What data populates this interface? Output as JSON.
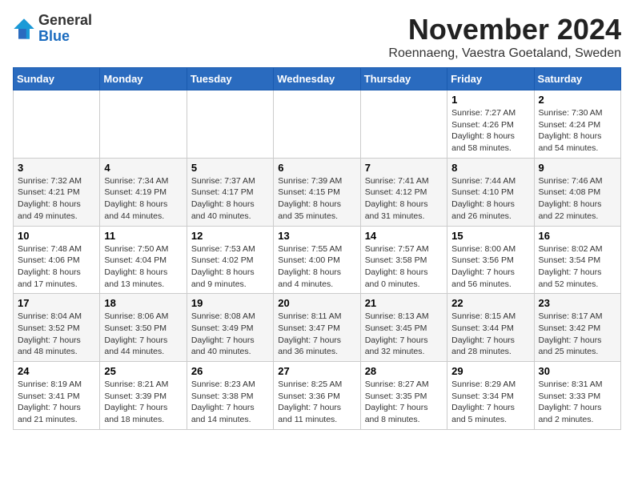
{
  "header": {
    "logo": {
      "line1": "General",
      "line2": "Blue"
    },
    "title": "November 2024",
    "subtitle": "Roennaeng, Vaestra Goetaland, Sweden"
  },
  "calendar": {
    "days_of_week": [
      "Sunday",
      "Monday",
      "Tuesday",
      "Wednesday",
      "Thursday",
      "Friday",
      "Saturday"
    ],
    "weeks": [
      [
        {
          "day": "",
          "info": ""
        },
        {
          "day": "",
          "info": ""
        },
        {
          "day": "",
          "info": ""
        },
        {
          "day": "",
          "info": ""
        },
        {
          "day": "",
          "info": ""
        },
        {
          "day": "1",
          "info": "Sunrise: 7:27 AM\nSunset: 4:26 PM\nDaylight: 8 hours\nand 58 minutes."
        },
        {
          "day": "2",
          "info": "Sunrise: 7:30 AM\nSunset: 4:24 PM\nDaylight: 8 hours\nand 54 minutes."
        }
      ],
      [
        {
          "day": "3",
          "info": "Sunrise: 7:32 AM\nSunset: 4:21 PM\nDaylight: 8 hours\nand 49 minutes."
        },
        {
          "day": "4",
          "info": "Sunrise: 7:34 AM\nSunset: 4:19 PM\nDaylight: 8 hours\nand 44 minutes."
        },
        {
          "day": "5",
          "info": "Sunrise: 7:37 AM\nSunset: 4:17 PM\nDaylight: 8 hours\nand 40 minutes."
        },
        {
          "day": "6",
          "info": "Sunrise: 7:39 AM\nSunset: 4:15 PM\nDaylight: 8 hours\nand 35 minutes."
        },
        {
          "day": "7",
          "info": "Sunrise: 7:41 AM\nSunset: 4:12 PM\nDaylight: 8 hours\nand 31 minutes."
        },
        {
          "day": "8",
          "info": "Sunrise: 7:44 AM\nSunset: 4:10 PM\nDaylight: 8 hours\nand 26 minutes."
        },
        {
          "day": "9",
          "info": "Sunrise: 7:46 AM\nSunset: 4:08 PM\nDaylight: 8 hours\nand 22 minutes."
        }
      ],
      [
        {
          "day": "10",
          "info": "Sunrise: 7:48 AM\nSunset: 4:06 PM\nDaylight: 8 hours\nand 17 minutes."
        },
        {
          "day": "11",
          "info": "Sunrise: 7:50 AM\nSunset: 4:04 PM\nDaylight: 8 hours\nand 13 minutes."
        },
        {
          "day": "12",
          "info": "Sunrise: 7:53 AM\nSunset: 4:02 PM\nDaylight: 8 hours\nand 9 minutes."
        },
        {
          "day": "13",
          "info": "Sunrise: 7:55 AM\nSunset: 4:00 PM\nDaylight: 8 hours\nand 4 minutes."
        },
        {
          "day": "14",
          "info": "Sunrise: 7:57 AM\nSunset: 3:58 PM\nDaylight: 8 hours\nand 0 minutes."
        },
        {
          "day": "15",
          "info": "Sunrise: 8:00 AM\nSunset: 3:56 PM\nDaylight: 7 hours\nand 56 minutes."
        },
        {
          "day": "16",
          "info": "Sunrise: 8:02 AM\nSunset: 3:54 PM\nDaylight: 7 hours\nand 52 minutes."
        }
      ],
      [
        {
          "day": "17",
          "info": "Sunrise: 8:04 AM\nSunset: 3:52 PM\nDaylight: 7 hours\nand 48 minutes."
        },
        {
          "day": "18",
          "info": "Sunrise: 8:06 AM\nSunset: 3:50 PM\nDaylight: 7 hours\nand 44 minutes."
        },
        {
          "day": "19",
          "info": "Sunrise: 8:08 AM\nSunset: 3:49 PM\nDaylight: 7 hours\nand 40 minutes."
        },
        {
          "day": "20",
          "info": "Sunrise: 8:11 AM\nSunset: 3:47 PM\nDaylight: 7 hours\nand 36 minutes."
        },
        {
          "day": "21",
          "info": "Sunrise: 8:13 AM\nSunset: 3:45 PM\nDaylight: 7 hours\nand 32 minutes."
        },
        {
          "day": "22",
          "info": "Sunrise: 8:15 AM\nSunset: 3:44 PM\nDaylight: 7 hours\nand 28 minutes."
        },
        {
          "day": "23",
          "info": "Sunrise: 8:17 AM\nSunset: 3:42 PM\nDaylight: 7 hours\nand 25 minutes."
        }
      ],
      [
        {
          "day": "24",
          "info": "Sunrise: 8:19 AM\nSunset: 3:41 PM\nDaylight: 7 hours\nand 21 minutes."
        },
        {
          "day": "25",
          "info": "Sunrise: 8:21 AM\nSunset: 3:39 PM\nDaylight: 7 hours\nand 18 minutes."
        },
        {
          "day": "26",
          "info": "Sunrise: 8:23 AM\nSunset: 3:38 PM\nDaylight: 7 hours\nand 14 minutes."
        },
        {
          "day": "27",
          "info": "Sunrise: 8:25 AM\nSunset: 3:36 PM\nDaylight: 7 hours\nand 11 minutes."
        },
        {
          "day": "28",
          "info": "Sunrise: 8:27 AM\nSunset: 3:35 PM\nDaylight: 7 hours\nand 8 minutes."
        },
        {
          "day": "29",
          "info": "Sunrise: 8:29 AM\nSunset: 3:34 PM\nDaylight: 7 hours\nand 5 minutes."
        },
        {
          "day": "30",
          "info": "Sunrise: 8:31 AM\nSunset: 3:33 PM\nDaylight: 7 hours\nand 2 minutes."
        }
      ]
    ]
  }
}
